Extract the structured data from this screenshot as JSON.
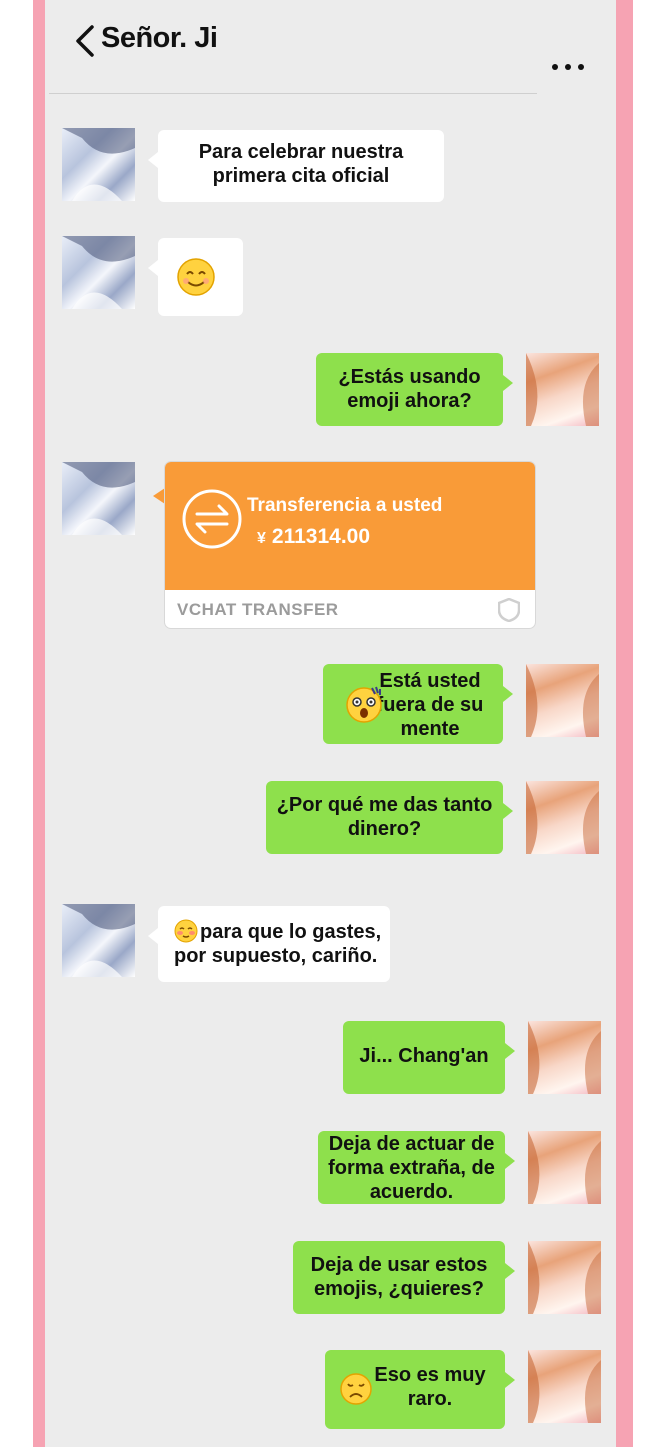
{
  "header": {
    "title": "Señor. Ji"
  },
  "messages": [
    {
      "text": "Para celebrar nuestra primera cita oficial"
    },
    {
      "text": ""
    },
    {
      "text": "¿Estás usando emoji ahora?"
    },
    {
      "transfer": {
        "title": "Transferencia a usted",
        "currency": "¥",
        "amount": "211314.00",
        "footer": "VCHAT TRANSFER"
      }
    },
    {
      "text": "Está usted fuera de su mente"
    },
    {
      "text": "¿Por qué me das tanto dinero?"
    },
    {
      "text": "para que lo gastes, por supuesto, cariño."
    },
    {
      "text": "Ji... Chang'an"
    },
    {
      "text": "Deja de actuar de forma extraña, de acuerdo."
    },
    {
      "text": "Deja de usar estos emojis, ¿quieres?"
    },
    {
      "text": "Eso es muy raro."
    }
  ],
  "lines": {
    "m0": [
      "Para celebrar nuestra",
      "primera cita oficial"
    ],
    "m2": [
      "¿Estás usando",
      "emoji ahora?"
    ],
    "m4": [
      "Está usted",
      "fuera de su",
      "mente"
    ],
    "m5": [
      "¿Por qué me das tanto",
      "dinero?"
    ],
    "m6": [
      "para que lo gastes,",
      "por supuesto, cariño."
    ],
    "m7": [
      "Ji... Chang'an"
    ],
    "m8": [
      "Deja de actuar de",
      "forma extraña, de",
      "acuerdo."
    ],
    "m9": [
      "Deja de usar estos",
      "emojis, ¿quieres?"
    ],
    "m10": [
      "Eso es muy",
      "raro."
    ]
  },
  "colors": {
    "frame": "#f6a3b3",
    "background": "#ececec",
    "sent_bubble": "#8ee04c",
    "received_bubble": "#ffffff",
    "transfer": "#f99b38"
  },
  "icons": [
    "back-chevron-icon",
    "more-dots-icon",
    "smile-emoji-icon",
    "transfer-arrows-icon",
    "shield-icon",
    "shocked-emoji-icon",
    "blush-emoji-icon",
    "sad-emoji-icon"
  ]
}
